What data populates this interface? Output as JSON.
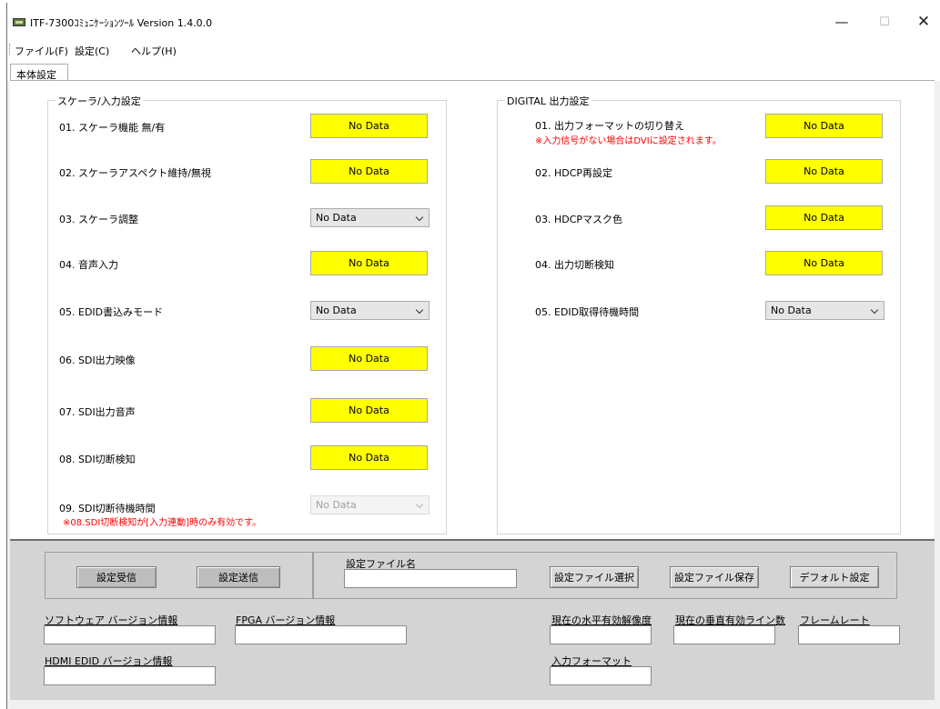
{
  "window": {
    "title": "ITF-7300ｺﾐｭﾆｹｰｼｮﾝﾂｰﾙ Version 1.4.0.0",
    "minimize_glyph": "—",
    "maximize_glyph": "☐",
    "close_glyph": "✕"
  },
  "menu": [
    "ファイル(F)",
    "設定(C)",
    "ヘルプ(H)"
  ],
  "tabs": [
    "本体設定"
  ],
  "scaler_group": {
    "title": "スケーラ/入力設定",
    "rows": [
      {
        "label": "01. スケーラ機能 無/有",
        "value": "No Data",
        "control": "button"
      },
      {
        "label": "02. スケーラアスペクト維持/無視",
        "value": "No Data",
        "control": "button"
      },
      {
        "label": "03. スケーラ調整",
        "value": "No Data",
        "control": "combo"
      },
      {
        "label": "04. 音声入力",
        "value": "No Data",
        "control": "button"
      },
      {
        "label": "05. EDID書込みモード",
        "value": "No Data",
        "control": "combo"
      },
      {
        "label": "06. SDI出力映像",
        "value": "No Data",
        "control": "button"
      },
      {
        "label": "07. SDI出力音声",
        "value": "No Data",
        "control": "button"
      },
      {
        "label": "08. SDI切断検知",
        "value": "No Data",
        "control": "button"
      },
      {
        "label": "09. SDI切断待機時間",
        "value": "No Data",
        "control": "combo-disabled"
      }
    ],
    "note": "※08.SDI切断検知が[入力連動]時のみ有効です。"
  },
  "digital_group": {
    "title": "DIGITAL 出力設定",
    "rows": [
      {
        "label": "01. 出力フォーマットの切り替え",
        "value": "No Data",
        "control": "button"
      },
      {
        "label": "02. HDCP再設定",
        "value": "No Data",
        "control": "button"
      },
      {
        "label": "03. HDCPマスク色",
        "value": "No Data",
        "control": "button"
      },
      {
        "label": "04. 出力切断検知",
        "value": "No Data",
        "control": "button"
      },
      {
        "label": "05. EDID取得待機時間",
        "value": "No Data",
        "control": "combo"
      }
    ],
    "note": "※入力信号がない場合はDVIに設定されます。"
  },
  "bottom": {
    "receive_button": "設定受信",
    "send_button": "設定送信",
    "file_name_label": "設定ファイル名",
    "file_name_value": "",
    "select_file_button": "設定ファイル選択",
    "save_file_button": "設定ファイル保存",
    "default_button": "デフォルト設定",
    "software_version_label": "ソフトウェア  バージョン情報",
    "software_version_value": "",
    "fpga_version_label": "FPGA  バージョン情報",
    "fpga_version_value": "",
    "hdmi_edid_version_label": "HDMI EDID  バージョン情報",
    "hdmi_edid_version_value": "",
    "h_resolution_label": "現在の水平有効解像度",
    "h_resolution_value": "",
    "v_lines_label": "現在の垂直有効ライン数",
    "v_lines_value": "",
    "frame_rate_label": "フレームレート",
    "frame_rate_value": "",
    "input_format_label": "入力フォーマット",
    "input_format_value": ""
  }
}
